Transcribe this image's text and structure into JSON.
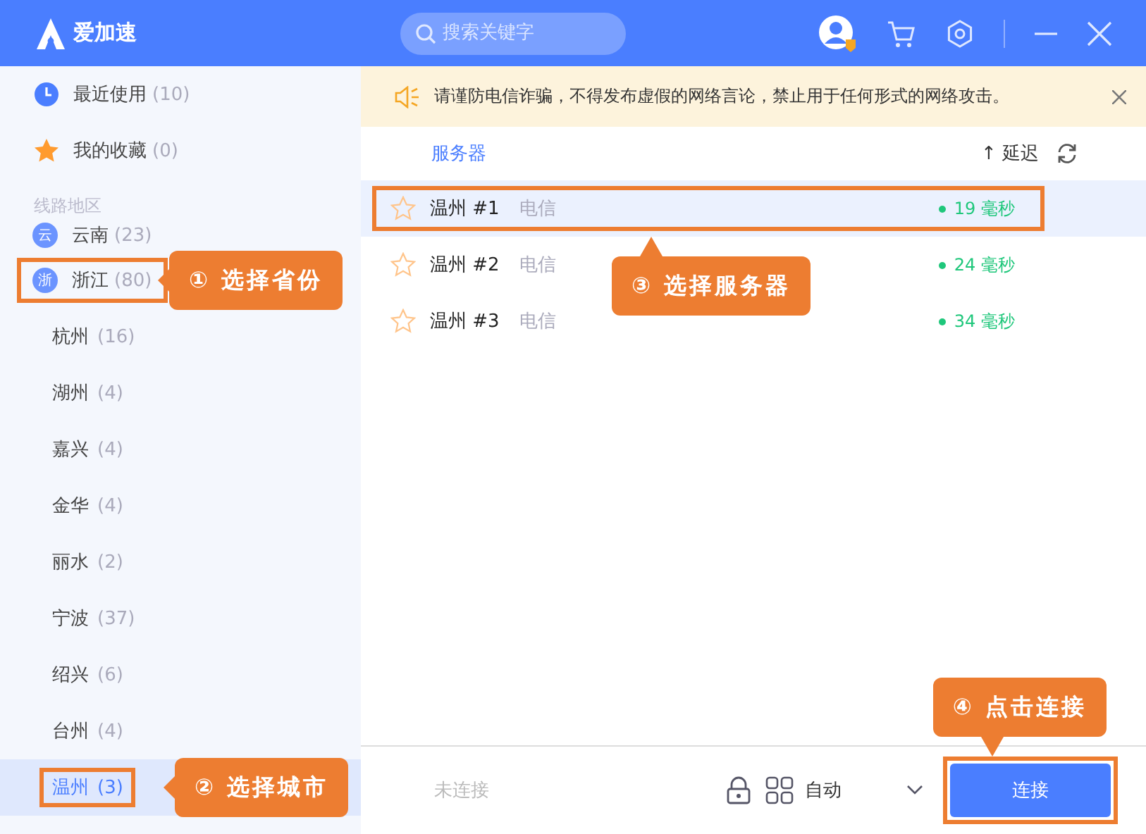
{
  "app": {
    "name": "爱加速"
  },
  "search": {
    "placeholder": "搜索关键字"
  },
  "sidebar": {
    "quick": [
      {
        "kind": "recent",
        "label": "最近使用",
        "count": "(10)"
      },
      {
        "kind": "favorite",
        "label": "我的收藏",
        "count": "(0)"
      }
    ],
    "section_title": "线路地区",
    "provinces": [
      {
        "badge": "云",
        "name": "云南",
        "count": "(23)",
        "outlined": false,
        "expanded": false
      },
      {
        "badge": "浙",
        "name": "浙江",
        "count": "(80)",
        "outlined": true,
        "callout": "① 选择省份",
        "expanded": true,
        "children": [
          {
            "name": "杭州",
            "count": "(16)",
            "selected": false,
            "outlined": false
          },
          {
            "name": "湖州",
            "count": "(4)",
            "selected": false,
            "outlined": false
          },
          {
            "name": "嘉兴",
            "count": "(4)",
            "selected": false,
            "outlined": false
          },
          {
            "name": "金华",
            "count": "(4)",
            "selected": false,
            "outlined": false
          },
          {
            "name": "丽水",
            "count": "(2)",
            "selected": false,
            "outlined": false
          },
          {
            "name": "宁波",
            "count": "(37)",
            "selected": false,
            "outlined": false
          },
          {
            "name": "绍兴",
            "count": "(6)",
            "selected": false,
            "outlined": false
          },
          {
            "name": "台州",
            "count": "(4)",
            "selected": false,
            "outlined": false
          },
          {
            "name": "温州",
            "count": "(3)",
            "selected": true,
            "outlined": true,
            "callout": "② 选择城市"
          }
        ]
      }
    ]
  },
  "notice": {
    "text": "请谨防电信诈骗，不得发布虚假的网络言论，禁止用于任何形式的网络攻击。"
  },
  "servers": {
    "column_name": "服务器",
    "column_latency": "↑ 延迟",
    "rows": [
      {
        "name": "温州 #1",
        "isp": "电信",
        "latency": "19 毫秒",
        "selected": true,
        "favorite": false,
        "outlined": true,
        "callout": "③ 选择服务器"
      },
      {
        "name": "温州 #2",
        "isp": "电信",
        "latency": "24 毫秒",
        "selected": false,
        "favorite": false,
        "outlined": false
      },
      {
        "name": "温州 #3",
        "isp": "电信",
        "latency": "34 毫秒",
        "selected": false,
        "favorite": false,
        "outlined": false
      }
    ]
  },
  "footer": {
    "status": "未连接",
    "mode": "自动",
    "connect": {
      "label": "连接",
      "outlined": true,
      "callout": "④ 点击连接"
    }
  }
}
